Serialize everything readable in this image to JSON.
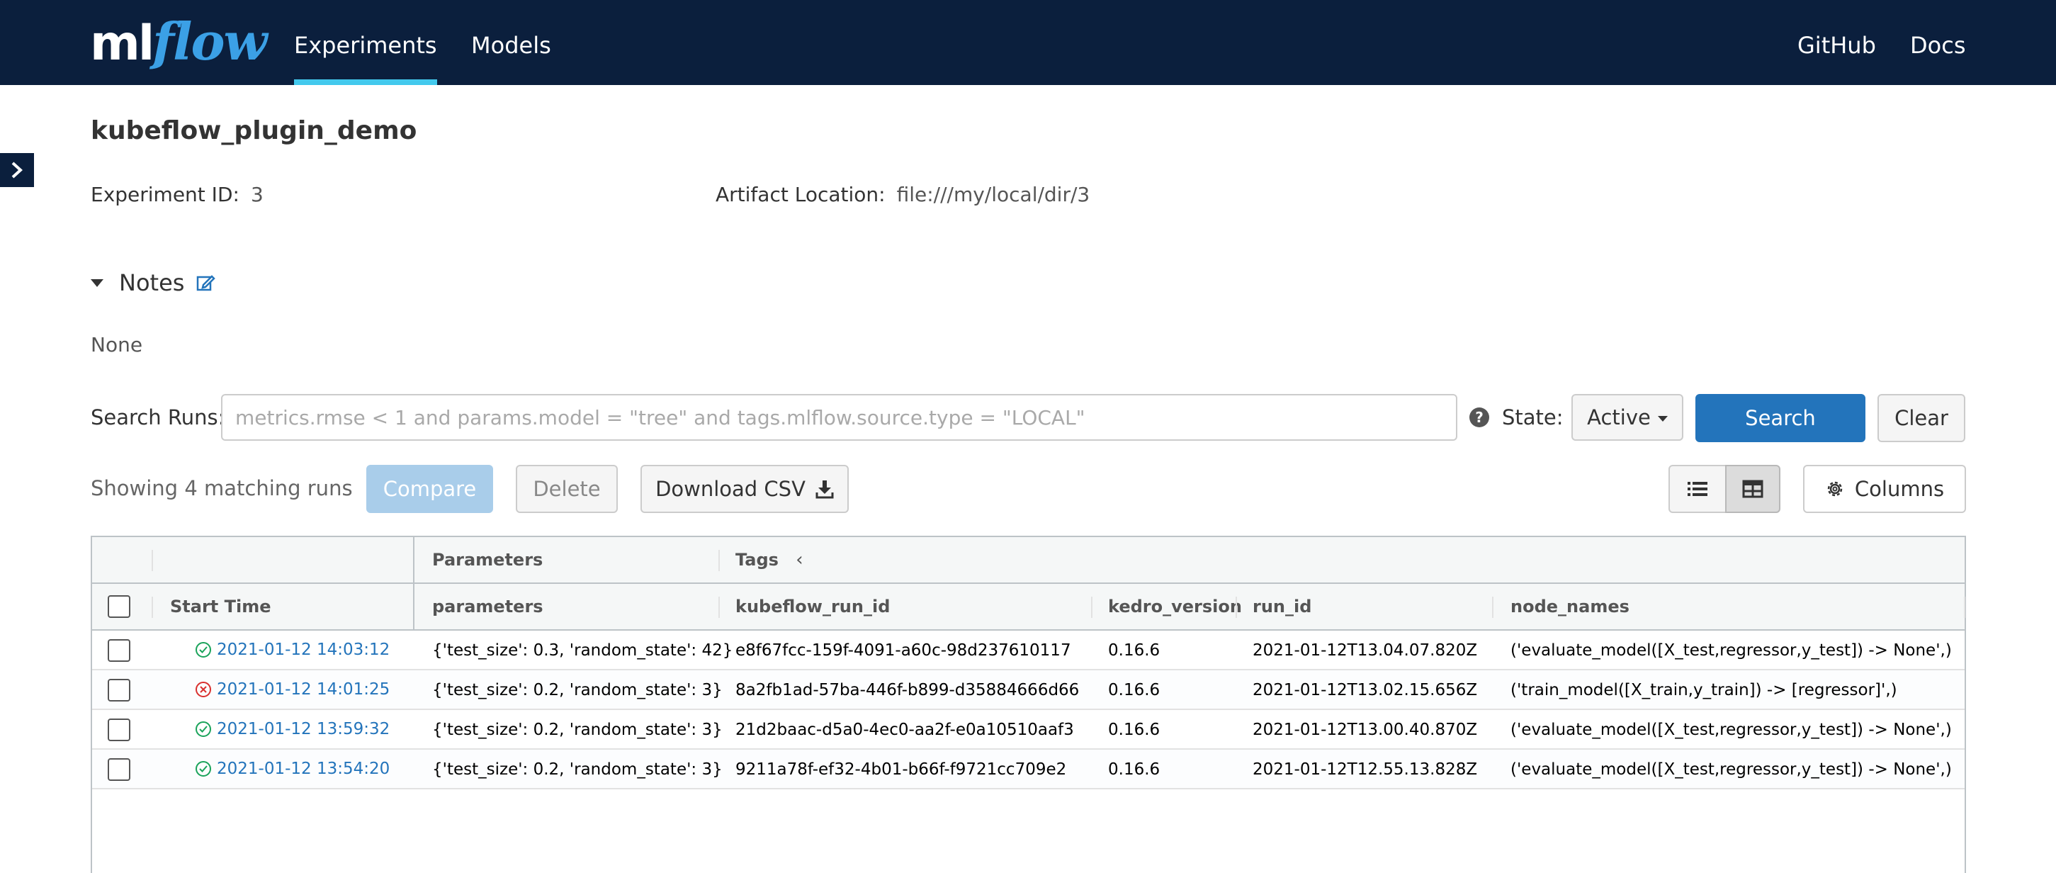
{
  "app": {
    "logo_ml": "ml",
    "logo_flow": "flow",
    "nav": [
      {
        "label": "Experiments",
        "active": true
      },
      {
        "label": "Models",
        "active": false
      }
    ],
    "nav_right": [
      {
        "label": "GitHub"
      },
      {
        "label": "Docs"
      }
    ],
    "colors": {
      "header_bg": "#0b1f3d",
      "accent": "#43c9ed",
      "primary": "#2374bb"
    }
  },
  "experiment": {
    "name": "kubeflow_plugin_demo",
    "id_label": "Experiment ID:",
    "id_value": "3",
    "artifact_label": "Artifact Location:",
    "artifact_value": "file:///my/local/dir/3",
    "notes_label": "Notes",
    "notes_value": "None"
  },
  "search": {
    "label": "Search Runs:",
    "placeholder": "metrics.rmse < 1 and params.model = \"tree\" and tags.mlflow.source.type = \"LOCAL\"",
    "help_icon": "?",
    "state_label": "State:",
    "state_value": "Active",
    "search_button": "Search",
    "clear_button": "Clear"
  },
  "actions": {
    "showing": "Showing 4 matching runs",
    "compare": "Compare",
    "delete": "Delete",
    "download_csv": "Download CSV",
    "columns": "Columns"
  },
  "table": {
    "groups": {
      "parameters": "Parameters",
      "tags": "Tags"
    },
    "headers": {
      "start_time": "Start Time",
      "parameters": "parameters",
      "kubeflow_run_id": "kubeflow_run_id",
      "kedro_version": "kedro_version",
      "run_id": "run_id",
      "node_names": "node_names"
    },
    "rows": [
      {
        "status": "success",
        "start_time": "2021-01-12 14:03:12",
        "parameters": "{'test_size': 0.3, 'random_state': 42}",
        "kubeflow_run_id": "e8f67fcc-159f-4091-a60c-98d237610117",
        "kedro_version": "0.16.6",
        "run_id": "2021-01-12T13.04.07.820Z",
        "node_names": "('evaluate_model([X_test,regressor,y_test]) -> None',)"
      },
      {
        "status": "failed",
        "start_time": "2021-01-12 14:01:25",
        "parameters": "{'test_size': 0.2, 'random_state': 3}",
        "kubeflow_run_id": "8a2fb1ad-57ba-446f-b899-d35884666d66",
        "kedro_version": "0.16.6",
        "run_id": "2021-01-12T13.02.15.656Z",
        "node_names": "('train_model([X_train,y_train]) -> [regressor]',)"
      },
      {
        "status": "success",
        "start_time": "2021-01-12 13:59:32",
        "parameters": "{'test_size': 0.2, 'random_state': 3}",
        "kubeflow_run_id": "21d2baac-d5a0-4ec0-aa2f-e0a10510aaf3",
        "kedro_version": "0.16.6",
        "run_id": "2021-01-12T13.00.40.870Z",
        "node_names": "('evaluate_model([X_test,regressor,y_test]) -> None',)"
      },
      {
        "status": "success",
        "start_time": "2021-01-12 13:54:20",
        "parameters": "{'test_size': 0.2, 'random_state': 3}",
        "kubeflow_run_id": "9211a78f-ef32-4b01-b66f-f9721cc709e2",
        "kedro_version": "0.16.6",
        "run_id": "2021-01-12T12.55.13.828Z",
        "node_names": "('evaluate_model([X_test,regressor,y_test]) -> None',)"
      }
    ]
  }
}
